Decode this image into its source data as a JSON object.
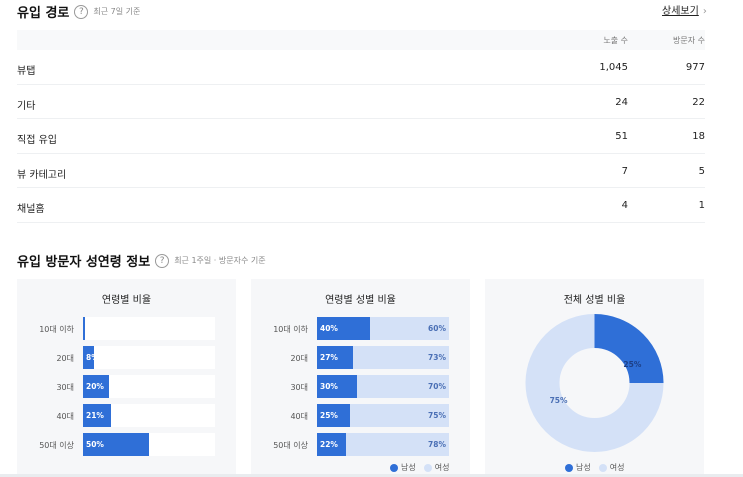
{
  "inflow": {
    "title": "유입 경로",
    "note": "최근 7일 기준",
    "detail": "상세보기",
    "col_views": "노출 수",
    "col_visitors": "방문자 수",
    "rows": [
      {
        "label": "뷰탭",
        "views": "1,045",
        "visitors": "977"
      },
      {
        "label": "기타",
        "views": "24",
        "visitors": "22"
      },
      {
        "label": "직접 유입",
        "views": "51",
        "visitors": "18"
      },
      {
        "label": "뷰 카테고리",
        "views": "7",
        "visitors": "5"
      },
      {
        "label": "채널홈",
        "views": "4",
        "visitors": "1"
      }
    ]
  },
  "demo": {
    "title": "유입 방문자 성연령 정보",
    "note": "최근 1주일 · 방문자수 기준",
    "age_card_title": "연령별 비율",
    "agegender_card_title": "연령별 성별 비율",
    "gender_card_title": "전체 성별 비율",
    "legend_male": "남성",
    "legend_female": "여성"
  },
  "chart_data": [
    {
      "type": "bar",
      "title": "연령별 비율",
      "categories": [
        "10대 이하",
        "20대",
        "30대",
        "40대",
        "50대 이상"
      ],
      "values": [
        0,
        8,
        20,
        21,
        50
      ],
      "labels": [
        "",
        "8%",
        "20%",
        "21%",
        "50%"
      ],
      "ylim": [
        0,
        100
      ]
    },
    {
      "type": "bar",
      "title": "연령별 성별 비율",
      "categories": [
        "10대 이하",
        "20대",
        "30대",
        "40대",
        "50대 이상"
      ],
      "series": [
        {
          "name": "남성",
          "values": [
            40,
            27,
            30,
            25,
            22
          ],
          "labels": [
            "40%",
            "27%",
            "30%",
            "25%",
            "22%"
          ]
        },
        {
          "name": "여성",
          "values": [
            60,
            73,
            70,
            75,
            78
          ],
          "labels": [
            "60%",
            "73%",
            "70%",
            "75%",
            "78%"
          ]
        }
      ],
      "stacked": true
    },
    {
      "type": "pie",
      "title": "전체 성별 비율",
      "categories": [
        "남성",
        "여성"
      ],
      "values": [
        25,
        75
      ],
      "labels": [
        "25%",
        "75%"
      ]
    }
  ],
  "colors": {
    "male": "#2f6fd7",
    "female": "#d4e1f7",
    "card_bg": "#f6f7f9"
  }
}
